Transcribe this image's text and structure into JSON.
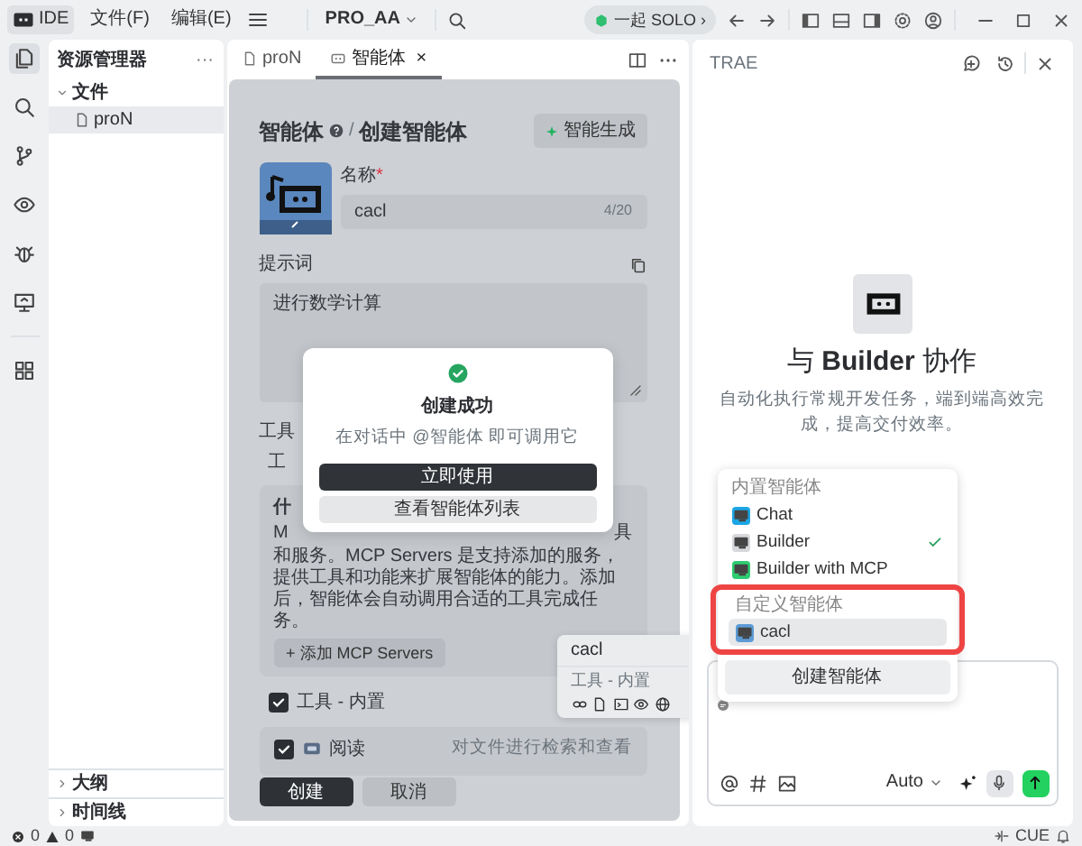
{
  "title_bar": {
    "app": "IDE",
    "menus": [
      "文件(F)",
      "编辑(E)"
    ],
    "project": "PRO_AA",
    "solo": "一起 SOLO ›"
  },
  "activity_bar": [
    {
      "kind": "files",
      "selected": true
    },
    {
      "kind": "search",
      "selected": false
    },
    {
      "kind": "branch",
      "selected": false
    },
    {
      "kind": "eye",
      "selected": false
    },
    {
      "kind": "bug",
      "selected": false
    },
    {
      "kind": "remote",
      "selected": false
    },
    {
      "kind": "grid",
      "selected": false
    }
  ],
  "explorer": {
    "title": "资源管理器",
    "more": "···",
    "tree": [
      {
        "label": "文件",
        "expanded": true,
        "children": [
          {
            "label": "proN",
            "selected": true
          }
        ]
      }
    ],
    "sections": [
      {
        "label": "大纲",
        "expanded": false
      },
      {
        "label": "时间线",
        "expanded": false
      }
    ]
  },
  "editor_tabs": [
    {
      "label": "proN",
      "kind": "file",
      "selected": false
    },
    {
      "label": "智能体",
      "kind": "agent",
      "selected": true,
      "close": "×"
    }
  ],
  "form": {
    "breadcrumb": [
      "智能体",
      "/",
      "创建智能体"
    ],
    "generate": "智能生成",
    "name_label": "名称",
    "required_mark": "*",
    "name_value": "cacl",
    "name_count": "4/20",
    "prompt_label": "提示词",
    "prompt_value": "进行数学计算",
    "tools_label": "工具",
    "tools_sub": "工",
    "mcp_title": "什",
    "mcp_line_start": "M",
    "mcp_line_end": "具",
    "mcp_text": "和服务。MCP Servers 是支持添加的服务，提供工具和功能来扩展智能体的能力。添加后，智能体会自动调用合适的工具完成任务。",
    "mcp_add": "+ 添加 MCP Servers",
    "tools": [
      {
        "kind": "group",
        "label": "工具 - 内置",
        "checked": true
      },
      {
        "kind": "tool",
        "label": "阅读",
        "checked": true,
        "description": "对文件进行检索和查看"
      }
    ],
    "buttons": [
      {
        "label": "创建",
        "primary": true
      },
      {
        "label": "取消",
        "primary": false
      }
    ]
  },
  "modal": {
    "title": "创建成功",
    "message": "在对话中 @智能体 即可调用它",
    "buttons": [
      {
        "label": "立即使用",
        "primary": true
      },
      {
        "label": "查看智能体列表",
        "primary": false
      }
    ]
  },
  "tooltip": {
    "title": "cacl",
    "subtitle": "工具 - 内置"
  },
  "assistant": {
    "title": "TRAE",
    "heading": "与 **Builder** 协作",
    "description": "自动化执行常规开发任务，端到端高效完成，提高交付效率。",
    "menu": [
      {
        "heading": "内置智能体",
        "framed": false,
        "items": [
          {
            "label": "Chat",
            "color": "#1ba6e6",
            "current": false,
            "highlighted": false
          },
          {
            "label": "Builder",
            "color": "#d6d8db",
            "current": true,
            "highlighted": false
          },
          {
            "label": "Builder with MCP",
            "color": "#2ecc71",
            "current": false,
            "highlighted": false
          }
        ]
      },
      {
        "heading": "自定义智能体",
        "framed": true,
        "items": [
          {
            "label": "cacl",
            "color": "#5b9bd5",
            "current": false,
            "highlighted": true
          }
        ]
      }
    ],
    "create": "创建智能体",
    "model": "Auto"
  },
  "status_bar": {
    "errors": "0",
    "warnings": "0",
    "cue": "CUE"
  }
}
